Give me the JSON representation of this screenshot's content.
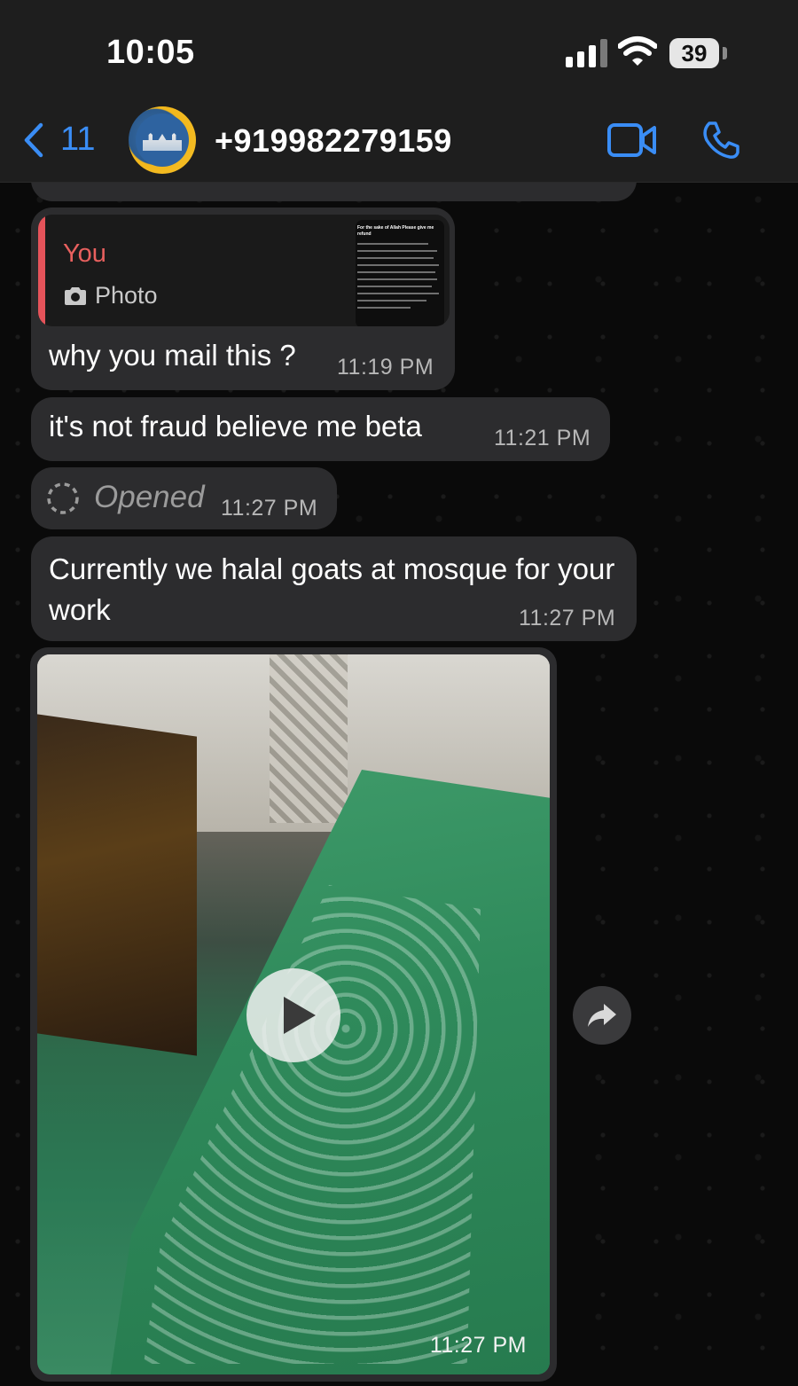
{
  "status_bar": {
    "time": "10:05",
    "battery": "39"
  },
  "header": {
    "back_count": "11",
    "contact": "+919982279159",
    "avatar_icon": "mosque-avatar",
    "video_icon": "video-camera-icon",
    "call_icon": "phone-icon",
    "accent_color": "#3a8df5"
  },
  "messages": [
    {
      "quote": {
        "author": "You",
        "type": "Photo",
        "thumb_title": "For the sake of Allah Please give me refund"
      },
      "text": "why you mail this ?",
      "time": "11:19 PM"
    },
    {
      "text": "it's not fraud believe me beta",
      "time": "11:21 PM"
    },
    {
      "opened": "Opened",
      "time": "11:27 PM"
    },
    {
      "text": "Currently we halal goats at mosque for your work",
      "time": "11:27 PM"
    },
    {
      "media": "video",
      "time": "11:27 PM"
    }
  ],
  "colors": {
    "bubble": "#2c2c2e",
    "quote_bar": "#e5535a",
    "header_bg": "#1e1e1e"
  }
}
